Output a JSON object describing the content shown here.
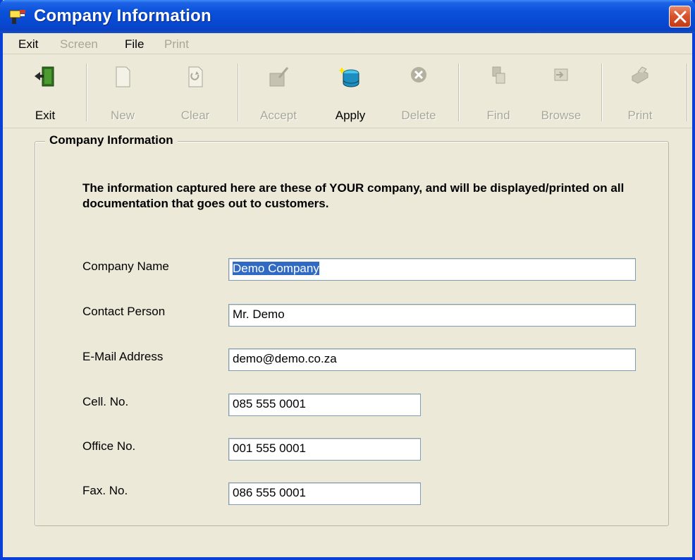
{
  "window": {
    "title": "Company Information",
    "icon": "app-icon",
    "close_icon": "close-icon"
  },
  "menu": {
    "items": [
      {
        "label": "Exit",
        "enabled": true
      },
      {
        "label": "Screen",
        "enabled": false
      },
      {
        "label": "File",
        "enabled": true
      },
      {
        "label": "Print",
        "enabled": false
      }
    ]
  },
  "toolbar": {
    "buttons": [
      {
        "label": "Exit",
        "icon": "exit-door-icon",
        "enabled": true
      },
      {
        "label": "New",
        "icon": "new-page-icon",
        "enabled": false
      },
      {
        "label": "Clear",
        "icon": "clear-page-icon",
        "enabled": false
      },
      {
        "label": "Accept",
        "icon": "accept-icon",
        "enabled": false
      },
      {
        "label": "Apply",
        "icon": "apply-icon",
        "enabled": true
      },
      {
        "label": "Delete",
        "icon": "delete-icon",
        "enabled": false
      },
      {
        "label": "Find",
        "icon": "find-icon",
        "enabled": false
      },
      {
        "label": "Browse",
        "icon": "browse-icon",
        "enabled": false
      },
      {
        "label": "Print",
        "icon": "print-icon",
        "enabled": false
      }
    ]
  },
  "form": {
    "group_title": "Company Information",
    "intro": "The information captured here are these of YOUR company, and will be displayed/printed on all documentation that goes out to customers.",
    "fields": {
      "company_name": {
        "label": "Company Name",
        "value": "Demo Company"
      },
      "contact_person": {
        "label": "Contact Person",
        "value": "Mr. Demo"
      },
      "email": {
        "label": "E-Mail Address",
        "value": "demo@demo.co.za"
      },
      "cell": {
        "label": "Cell. No.",
        "value": "085 555 0001"
      },
      "office": {
        "label": "Office No.",
        "value": "001 555 0001"
      },
      "fax": {
        "label": "Fax. No.",
        "value": "086 555 0001"
      }
    }
  },
  "colors": {
    "titlebar": "#0a51da",
    "window_bg": "#ece9d8",
    "disabled_text": "#a9a797",
    "selection": "#316ac5"
  }
}
